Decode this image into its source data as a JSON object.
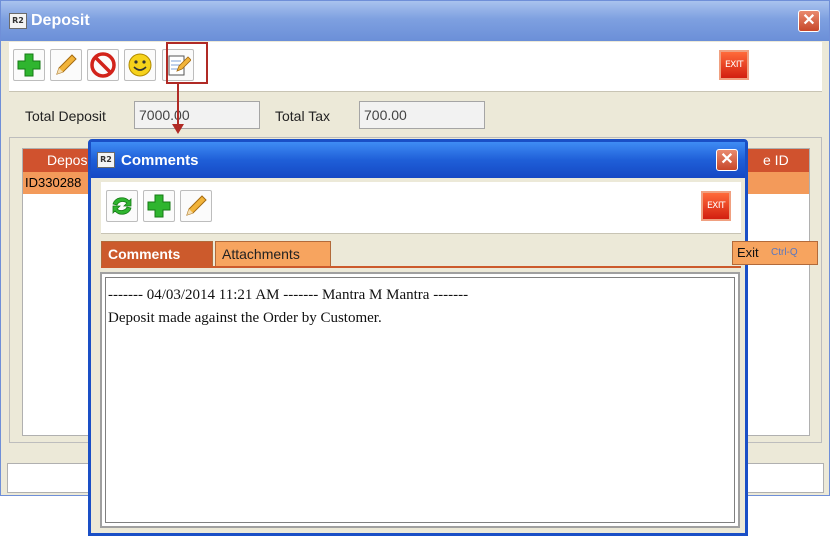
{
  "main_window": {
    "title": "Deposit",
    "app_icon_text": "R2",
    "close_symbol": "✕",
    "toolbar": {
      "add_icon": "plus-icon",
      "edit_icon": "pencil-icon",
      "cancel_icon": "no-entry-icon",
      "smiley_icon": "smiley-icon",
      "comments_icon": "notepad-edit-icon",
      "exit_label": "EXIT"
    },
    "total_deposit_label": "Total Deposit",
    "total_deposit_value": "7000.00",
    "total_tax_label": "Total Tax",
    "total_tax_value": "700.00",
    "grid": {
      "header_left": "Depos",
      "header_right": "e ID",
      "row_id": "ID330288"
    }
  },
  "comments_dialog": {
    "title": "Comments",
    "app_icon_text": "R2",
    "close_symbol": "✕",
    "toolbar": {
      "refresh_icon": "refresh-icon",
      "add_icon": "plus-icon",
      "edit_icon": "pencil-icon",
      "exit_label": "EXIT"
    },
    "tabs": [
      {
        "label": "Comments",
        "active": true
      },
      {
        "label": "Attachments",
        "active": false
      }
    ],
    "exit_shortcut": {
      "label": "Exit",
      "key": "Ctrl-Q"
    },
    "comment_lines": [
      "------- 04/03/2014 11:21 AM ------- Mantra M Mantra -------",
      "Deposit made against the Order by Customer."
    ]
  },
  "colors": {
    "accent_orange": "#cc5a2c",
    "row_orange": "#f39a5a",
    "dialog_blue": "#1f5fd8",
    "highlight_red": "#b02a25"
  }
}
